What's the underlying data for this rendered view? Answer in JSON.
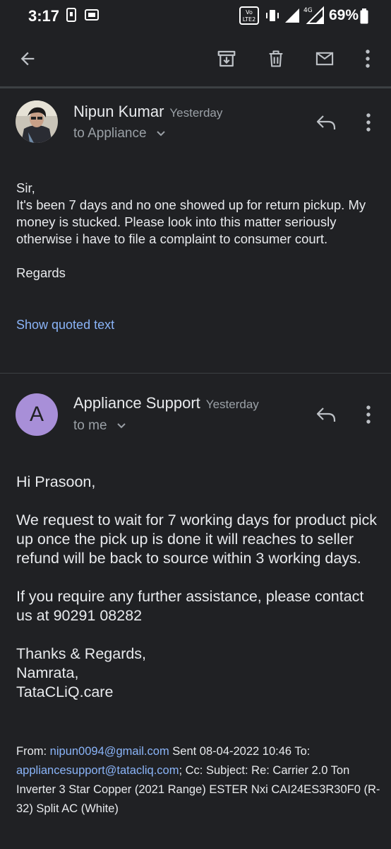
{
  "status_bar": {
    "time": "3:17",
    "battery": "69%",
    "network_label": "4G",
    "volte_label": "Vo LTE 2"
  },
  "toolbar": {
    "icons": [
      "back-arrow-icon",
      "archive-icon",
      "delete-icon",
      "mark-unread-icon",
      "more-vert-icon"
    ]
  },
  "messages": [
    {
      "sender": "Nipun Kumar",
      "time": "Yesterday",
      "recipient": "to Appliance",
      "body": [
        "Sir,",
        "It's been 7 days and no one showed up for return pickup. My money is stucked. Please look into this matter seriously otherwise i have to file a complaint to consumer court.",
        "",
        "Regards"
      ],
      "show_quoted": "Show quoted text"
    },
    {
      "sender": "Appliance Support",
      "avatar_letter": "A",
      "time": "Yesterday",
      "recipient": "to me",
      "body": {
        "greeting": "Hi Prasoon,",
        "para1": "We request to wait for 7 working days for product pick up once the pick up is done it will reaches to seller refund will be back to source within 3 working days.",
        "para2": "If you require any further assistance, please contact us at 90291 08282",
        "sign1": "Thanks & Regards,",
        "sign2": "Namrata,",
        "sign3": "TataCLiQ.care"
      },
      "quoted_header": {
        "from_label": "From: ",
        "from_email": "nipun0094@gmail.com",
        "sent": " Sent 08-04-2022 10:46 To: ",
        "to_email": "appliancesupport@tatacliq.com",
        "rest": "; Cc: Subject: Re: Carrier 2.0 Ton Inverter 3 Star Copper (2021 Range) ESTER Nxi CAI24ES3R30F0 (R-32) Split AC (White)"
      }
    }
  ],
  "colors": {
    "background": "#202124",
    "text": "#e8eaed",
    "secondary": "#9aa0a6",
    "link": "#8ab4f8",
    "avatar_purple": "#a88fd8"
  }
}
